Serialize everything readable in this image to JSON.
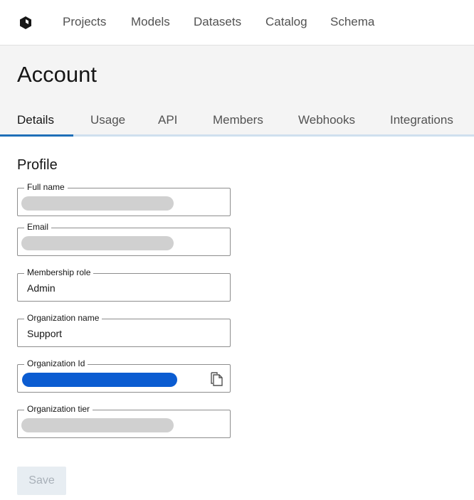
{
  "nav": {
    "logo_icon": "cube-logo-icon",
    "items": [
      {
        "label": "Projects"
      },
      {
        "label": "Models"
      },
      {
        "label": "Datasets"
      },
      {
        "label": "Catalog"
      },
      {
        "label": "Schema"
      }
    ]
  },
  "page": {
    "title": "Account"
  },
  "tabs": [
    {
      "label": "Details",
      "active": true
    },
    {
      "label": "Usage",
      "active": false
    },
    {
      "label": "API",
      "active": false
    },
    {
      "label": "Members",
      "active": false
    },
    {
      "label": "Webhooks",
      "active": false
    },
    {
      "label": "Integrations",
      "active": false
    }
  ],
  "profile": {
    "title": "Profile",
    "fields": {
      "full_name": {
        "label": "Full name",
        "value": null,
        "redacted": true
      },
      "email": {
        "label": "Email",
        "value": null,
        "redacted": true
      },
      "membership_role": {
        "label": "Membership role",
        "value": "Admin"
      },
      "organization_name": {
        "label": "Organization name",
        "value": "Support"
      },
      "organization_id": {
        "label": "Organization Id",
        "value": null,
        "redacted": true,
        "copy_icon": "copy-icon"
      },
      "organization_tier": {
        "label": "Organization tier",
        "value": null,
        "redacted": true
      }
    },
    "save_label": "Save"
  },
  "colors": {
    "accent": "#1f6fb8",
    "redaction_gray": "#d0d0d0",
    "redaction_blue": "#0b5cd1",
    "header_bg": "#f4f4f4"
  }
}
